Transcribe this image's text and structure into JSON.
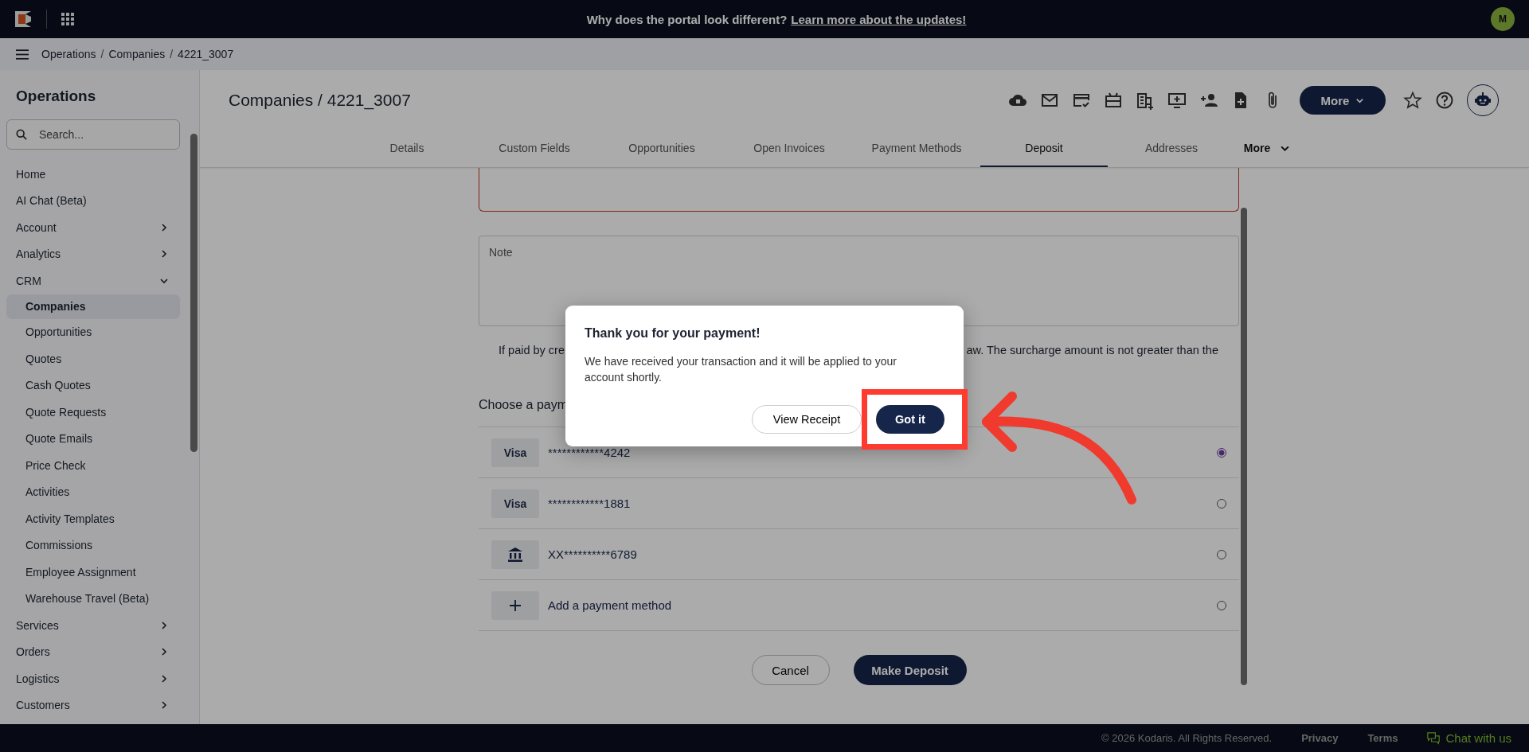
{
  "top_bar": {
    "announcement": "Why does the portal look different?",
    "announcement_link": "Learn more about the updates!",
    "avatar": "M"
  },
  "breadcrumb": {
    "separator": "/",
    "items": [
      "Operations",
      "Companies",
      "4221_3007"
    ]
  },
  "sidebar": {
    "title": "Operations",
    "search": {
      "placeholder": "Search..."
    },
    "items": [
      {
        "kind": "link",
        "label": "Home",
        "selected": false
      },
      {
        "kind": "link",
        "label": "AI Chat (Beta)",
        "selected": false
      },
      {
        "kind": "group",
        "label": "Account",
        "expanded": false,
        "selected": false
      },
      {
        "kind": "group",
        "label": "Analytics",
        "expanded": false,
        "selected": false
      },
      {
        "kind": "group",
        "label": "CRM",
        "expanded": true,
        "selected": false,
        "children": [
          {
            "label": "Companies",
            "selected": true
          },
          {
            "label": "Opportunities",
            "selected": false
          },
          {
            "label": "Quotes",
            "selected": false
          },
          {
            "label": "Cash Quotes",
            "selected": false
          },
          {
            "label": "Quote Requests",
            "selected": false
          },
          {
            "label": "Quote Emails",
            "selected": false
          },
          {
            "label": "Price Check",
            "selected": false
          },
          {
            "label": "Activities",
            "selected": false
          },
          {
            "label": "Activity Templates",
            "selected": false
          },
          {
            "label": "Commissions",
            "selected": false
          },
          {
            "label": "Employee Assignment",
            "selected": false
          },
          {
            "label": "Warehouse Travel (Beta)",
            "selected": false
          }
        ]
      },
      {
        "kind": "group",
        "label": "Services",
        "expanded": false,
        "selected": false
      },
      {
        "kind": "group",
        "label": "Orders",
        "expanded": false,
        "selected": false
      },
      {
        "kind": "group",
        "label": "Logistics",
        "expanded": false,
        "selected": false
      },
      {
        "kind": "group",
        "label": "Customers",
        "expanded": false,
        "selected": false
      }
    ]
  },
  "page_title": "Companies / 4221_3007",
  "toolbar": {
    "more_button": "More"
  },
  "tabs": [
    {
      "label": "Details",
      "selected": false
    },
    {
      "label": "Custom Fields",
      "selected": false
    },
    {
      "label": "Opportunities",
      "selected": false
    },
    {
      "label": "Open Invoices",
      "selected": false
    },
    {
      "label": "Payment Methods",
      "selected": false
    },
    {
      "label": "Deposit",
      "selected": true
    },
    {
      "label": "Addresses",
      "selected": false
    },
    {
      "label": "More",
      "kind": "menu",
      "selected": false
    }
  ],
  "form": {
    "note": {
      "placeholder": "Note"
    },
    "surcharge_left": "If paid by cre",
    "surcharge_right": "aw. The surcharge amount is not greater than the",
    "payment_heading": "Choose a paym",
    "payment_methods": [
      {
        "kind": "card",
        "badge": "Visa",
        "number": "************4242",
        "selected": true
      },
      {
        "kind": "card",
        "badge": "Visa",
        "number": "************1881",
        "selected": false
      },
      {
        "kind": "bank",
        "number": "XX**********6789",
        "selected": false
      },
      {
        "kind": "add",
        "label": "Add a payment method",
        "selected": false
      }
    ],
    "cancel_button": "Cancel",
    "submit_button": "Make Deposit"
  },
  "modal": {
    "title": "Thank you for your payment!",
    "body": "We have received your transaction and it will be applied to your account shortly.",
    "secondary_button": "View Receipt",
    "primary_button": "Got it"
  },
  "footer": {
    "copyright": "© 2026 Kodaris. All Rights Reserved.",
    "links": [
      "Privacy",
      "Terms"
    ],
    "chat": "Chat with us"
  }
}
